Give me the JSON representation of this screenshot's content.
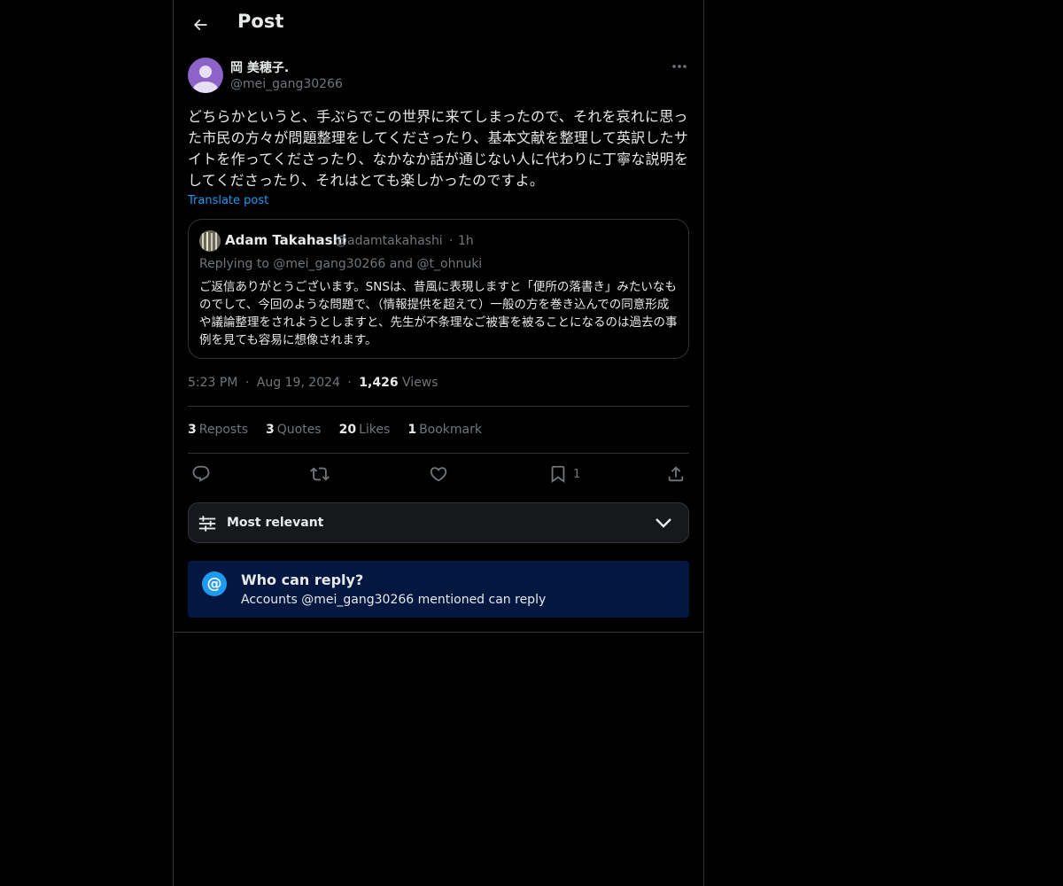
{
  "header": {
    "title": "Post"
  },
  "post": {
    "author_name": "岡 美穂子.",
    "author_handle": "@mei_gang30266",
    "text": "どちらかというと、手ぶらでこの世界に来てしまったので、それを哀れに思った市民の方々が問題整理をしてくださったり、基本文献を整理して英訳したサイトを作ってくださったり、なかなか話が通じない人に代わりに丁寧な説明をしてくださったり、それはとても楽しかったのですよ。",
    "translate_label": "Translate post"
  },
  "quote": {
    "name": "Adam Takahashi",
    "handle": "@adamtakahashi",
    "dot": "·",
    "time": "1h",
    "replying": "Replying to @mei_gang30266 and @t_ohnuki",
    "text": "ご返信ありがとうございます。SNSは、昔風に表現しますと「便所の落書き」みたいなものでして、今回のような問題で、（情報提供を超えて）一般の方を巻き込んでの同意形成や議論整理をされようとしますと、先生が不条理なご被害を被ることになるのは過去の事例を見ても容易に想像されます。"
  },
  "meta": {
    "time": "5:23 PM",
    "sep1": "·",
    "date": "Aug 19, 2024",
    "sep2": "·",
    "views_count": "1,426",
    "views_label": "Views"
  },
  "stats": {
    "reposts_count": "3",
    "reposts_label": "Reposts",
    "quotes_count": "3",
    "quotes_label": "Quotes",
    "likes_count": "20",
    "likes_label": "Likes",
    "bookmarks_count": "1",
    "bookmarks_label": "Bookmark"
  },
  "actions": {
    "icons": [
      "reply-icon",
      "repost-icon",
      "like-icon",
      "bookmark-icon",
      "share-icon"
    ],
    "bookmark_count": "1"
  },
  "sort": {
    "label": "Most relevant"
  },
  "who_can_reply": {
    "icon": "@",
    "title": "Who can reply?",
    "subtitle": "Accounts @mei_gang30266 mentioned can reply"
  },
  "colors": {
    "background": "#000000",
    "text": "#e7e9ea",
    "muted": "#71767b",
    "accent": "#1d9bf0",
    "border": "#2f3336",
    "avatar": "#8e63c9",
    "who_bg": "#031740"
  }
}
